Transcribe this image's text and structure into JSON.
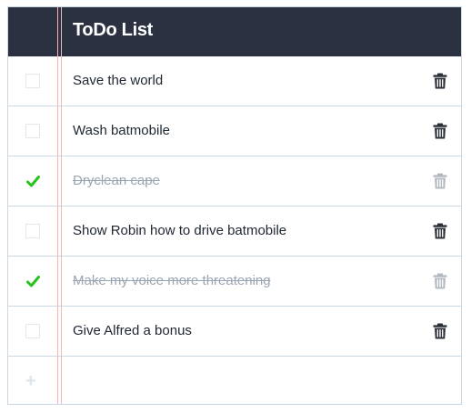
{
  "header": {
    "title": "ToDo List"
  },
  "tasks": [
    {
      "label": "Save the world",
      "completed": false
    },
    {
      "label": "Wash batmobile",
      "completed": false
    },
    {
      "label": "Dryclean cape",
      "completed": true
    },
    {
      "label": "Show Robin how to drive batmobile",
      "completed": false
    },
    {
      "label": "Make my voice more threatening",
      "completed": true
    },
    {
      "label": "Give Alfred a bonus",
      "completed": false
    }
  ],
  "add": {
    "icon": "plus-icon",
    "glyph": "+"
  },
  "icons": {
    "delete": "trash-icon",
    "check": "checkmark-icon"
  },
  "colors": {
    "header_bg": "#2b3140",
    "check": "#27c21e",
    "done_text": "#9aa6b2",
    "margin_line": "#f2b7b7"
  }
}
